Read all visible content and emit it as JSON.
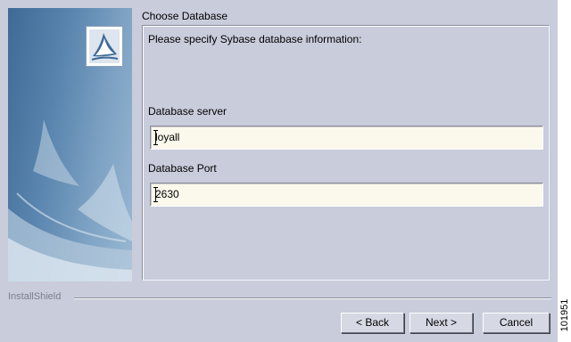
{
  "header": {
    "section_title": "Choose Database"
  },
  "content": {
    "prompt": "Please specify Sybase database information:",
    "server": {
      "label": "Database server",
      "value": "loyall"
    },
    "port": {
      "label": "Database Port",
      "value": "2630"
    }
  },
  "footer": {
    "brand": "InstallShield",
    "back_label": "< Back",
    "next_label": "Next >",
    "cancel_label": "Cancel"
  },
  "figure_number": "101951",
  "colors": {
    "dialog_bg": "#c9ccdb",
    "banner_blue": "#3e6a95",
    "field_bg": "#fbf8ec"
  },
  "icons": [
    "installer-logo-icon",
    "sail-graphic-icon"
  ]
}
